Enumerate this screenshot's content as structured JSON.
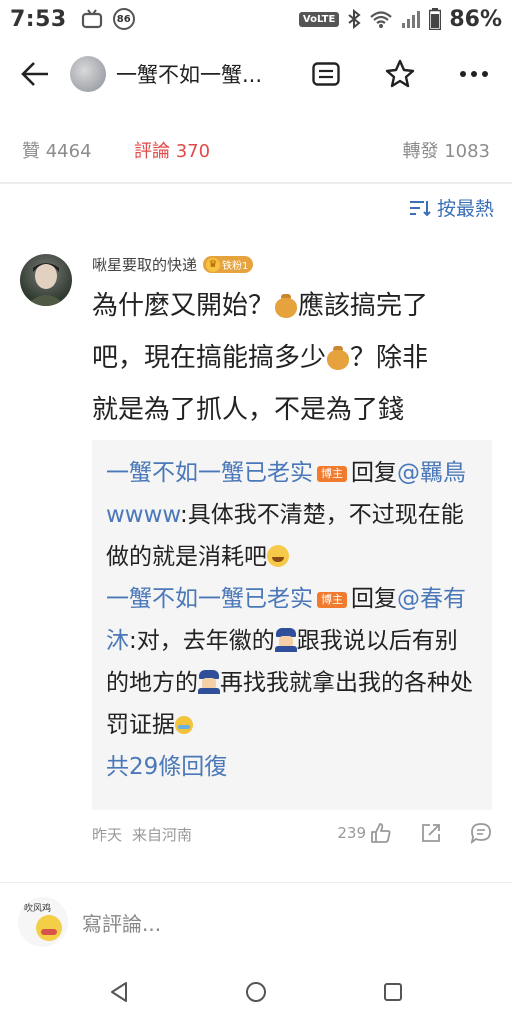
{
  "status_bar": {
    "time": "7:53",
    "badge": "86",
    "volte": "VoLTE",
    "battery": "86%"
  },
  "header": {
    "title": "一蟹不如一蟹..."
  },
  "tabs": {
    "like": "贊 4464",
    "comment": "評論 370",
    "repost": "轉發 1083"
  },
  "sort": {
    "label": "按最熱"
  },
  "comment": {
    "author": "啾星要取的快递",
    "fan_badge": "铁粉1",
    "text_line1_a": "為什麼又開始？",
    "text_line1_b": "應該搞完了",
    "text_line2_a": "吧，現在搞能搞多少",
    "text_line2_b": "？除非",
    "text_line3": "就是為了抓人，不是為了錢",
    "replies": [
      {
        "author": "一蟹不如一蟹已老实",
        "badge": "博主",
        "verb": "回复",
        "target": "@羈鳥wwww",
        "text": ":具体我不清楚，不过现在能做的就是消耗吧"
      },
      {
        "author": "一蟹不如一蟹已老实",
        "badge": "博主",
        "verb": "回复",
        "target": "@春有沐",
        "text_a": ":对，去年徽的",
        "text_b": "跟我说以后有别的地方的",
        "text_c": "再找我就拿出我的各种处罚证据"
      }
    ],
    "more_replies": "共29條回復",
    "time": "昨天",
    "location": "来自河南",
    "likes": "239"
  },
  "input": {
    "avatar_text": "吹风鸡",
    "placeholder": "寫評論..."
  },
  "colors": {
    "accent_red": "#e24a4a",
    "link_blue": "#4a78b8",
    "host_badge": "#f07a2d"
  }
}
